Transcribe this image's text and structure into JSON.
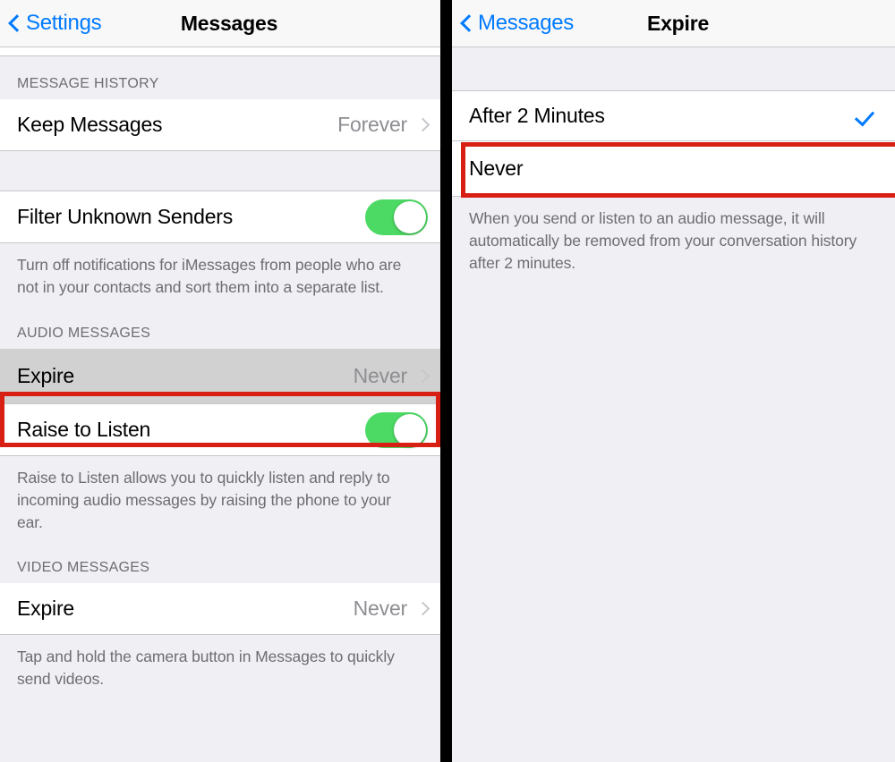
{
  "left_panel": {
    "navbar": {
      "back_label": "Settings",
      "back_icon": "chevron-left-icon",
      "title": "Messages"
    },
    "sections": [
      {
        "header": "MESSAGE HISTORY",
        "rows": [
          {
            "title": "Keep Messages",
            "value": "Forever",
            "accessory": "disclosure-icon"
          }
        ]
      },
      {
        "header": "",
        "rows": [
          {
            "title": "Filter Unknown Senders",
            "accessory": "toggle-on"
          }
        ],
        "footnote": "Turn off notifications for iMessages from people who are not in your contacts and sort them into a separate list."
      },
      {
        "header": "AUDIO MESSAGES",
        "rows": [
          {
            "title": "Expire",
            "value": "Never",
            "accessory": "disclosure-icon",
            "highlighted": true
          },
          {
            "title": "Raise to Listen",
            "accessory": "toggle-on"
          }
        ],
        "footnote": "Raise to Listen allows you to quickly listen and reply to incoming audio messages by raising the phone to your ear."
      },
      {
        "header": "VIDEO MESSAGES",
        "rows": [
          {
            "title": "Expire",
            "value": "Never",
            "accessory": "disclosure-icon"
          }
        ],
        "footnote": "Tap and hold the camera button in Messages to quickly send videos."
      }
    ]
  },
  "right_panel": {
    "navbar": {
      "back_label": "Messages",
      "back_icon": "chevron-left-icon",
      "title": "Expire"
    },
    "options": [
      {
        "label": "After 2 Minutes",
        "selected": true
      },
      {
        "label": "Never",
        "selected": false,
        "highlighted": true
      }
    ],
    "footnote": "When you send or listen to an audio message, it will automatically be removed from your conversation history after 2 minutes."
  },
  "colors": {
    "accent_blue": "#007aff",
    "toggle_green": "#4cd964",
    "highlight_red": "#d81f13",
    "group_background": "#efeff4",
    "pressed_cell": "#d1d1d1",
    "secondary_text": "#8e8e93"
  }
}
